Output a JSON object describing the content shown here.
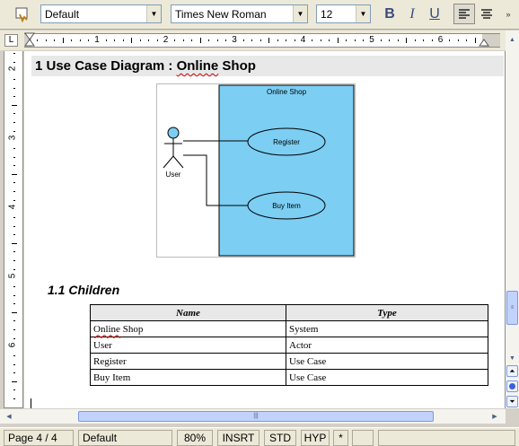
{
  "toolbar": {
    "style_value": "Default",
    "font_value": "Times New Roman",
    "size_value": "12",
    "bold_label": "B",
    "italic_label": "I",
    "underline_label": "U"
  },
  "ruler": {
    "corner_label": "L",
    "numbers": [
      "1",
      "2",
      "3",
      "4",
      "5",
      "6"
    ]
  },
  "vruler": {
    "numbers": [
      "2",
      "3",
      "4",
      "5",
      "6"
    ]
  },
  "document": {
    "heading1_prefix": "1 Use Case Diagram : ",
    "heading1_squiggle": "Online",
    "heading1_suffix": " Shop",
    "diagram": {
      "system_label": "Online Shop",
      "actor_label": "User",
      "use_case_1": "Register",
      "use_case_2": "Buy Item",
      "system_color": "#7ccef3"
    },
    "heading2": "1.1  Children",
    "table": {
      "headers": [
        "Name",
        "Type"
      ],
      "rows": [
        {
          "name_squiggle": "Online",
          "name_rest": " Shop",
          "type": "System"
        },
        {
          "name_squiggle": "",
          "name_rest": "User",
          "type": "Actor"
        },
        {
          "name_squiggle": "",
          "name_rest": "Register",
          "type": "Use Case"
        },
        {
          "name_squiggle": "",
          "name_rest": "Buy Item",
          "type": "Use Case"
        }
      ]
    }
  },
  "status": {
    "page": "Page 4 / 4",
    "page_style": "Default",
    "zoom": "80%",
    "insert_mode": "INSRT",
    "selection_mode": "STD",
    "hyphenation": "HYP",
    "modified": "*"
  },
  "icons": {
    "styles": "styles-icon",
    "scroll_up": "scroll-up-icon",
    "scroll_down": "scroll-down-icon",
    "scroll_left": "scroll-left-icon",
    "scroll_right": "scroll-right-icon",
    "prev_page": "previous-page-icon",
    "navigator": "navigator-icon",
    "next_page": "next-page-icon"
  }
}
